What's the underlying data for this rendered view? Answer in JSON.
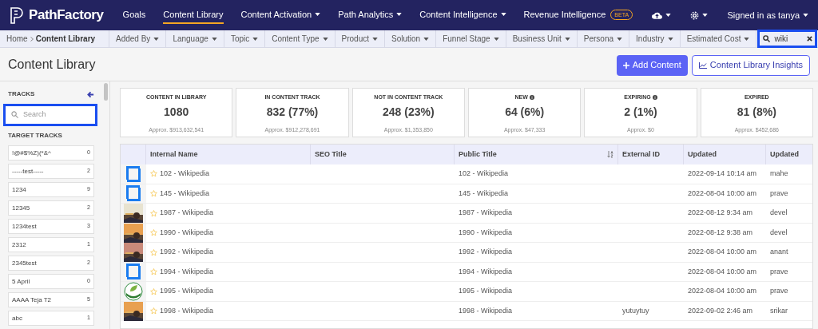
{
  "brand": {
    "name": "PathFactory"
  },
  "nav": [
    {
      "label": "Goals",
      "selected": false,
      "caret": false
    },
    {
      "label": "Content Library",
      "selected": true,
      "caret": false
    },
    {
      "label": "Content Activation",
      "selected": false,
      "caret": true
    },
    {
      "label": "Path Analytics",
      "selected": false,
      "caret": true
    },
    {
      "label": "Content Intelligence",
      "selected": false,
      "caret": true
    },
    {
      "label": "Revenue Intelligence",
      "selected": false,
      "caret": false,
      "badge": "BETA"
    }
  ],
  "user": {
    "label": "Signed in as tanya"
  },
  "breadcrumb": [
    "Home",
    "Content Library"
  ],
  "filters": [
    "Added By",
    "Language",
    "Topic",
    "Content Type",
    "Product",
    "Solution",
    "Funnel Stage",
    "Business Unit",
    "Persona",
    "Industry",
    "Estimated Cost"
  ],
  "search": {
    "value": "wiki"
  },
  "page": {
    "title": "Content Library",
    "buttons": [
      {
        "kind": "primary",
        "label": "Add Content"
      },
      {
        "kind": "outline",
        "label": "Content Library Insights"
      }
    ]
  },
  "sidebar": {
    "title": "TRACKS",
    "search": {
      "placeholder": "Search"
    },
    "section": "TARGET TRACKS",
    "tracks": [
      {
        "name": "!@#$%Z)(*&^",
        "count": "0"
      },
      {
        "name": "-----test-----",
        "count": "2"
      },
      {
        "name": "1234",
        "count": "9"
      },
      {
        "name": "12345",
        "count": "2"
      },
      {
        "name": "1234test",
        "count": "3"
      },
      {
        "name": "2312",
        "count": "1"
      },
      {
        "name": "2345test",
        "count": "2"
      },
      {
        "name": "5 April",
        "count": "0"
      },
      {
        "name": "AAAA Teja T2",
        "count": "5"
      },
      {
        "name": "abc",
        "count": "1"
      }
    ]
  },
  "stats": [
    {
      "title": "CONTENT IN LIBRARY",
      "info": false,
      "value": "1080",
      "approx": "Approx. $913,632,541"
    },
    {
      "title": "IN CONTENT TRACK",
      "info": false,
      "value": "832 (77%)",
      "approx": "Approx. $912,278,691"
    },
    {
      "title": "NOT IN CONTENT TRACK",
      "info": false,
      "value": "248 (23%)",
      "approx": "Approx. $1,353,850"
    },
    {
      "title": "NEW",
      "info": true,
      "value": "64 (6%)",
      "approx": "Approx. $47,333"
    },
    {
      "title": "EXPIRING",
      "info": true,
      "value": "2 (1%)",
      "approx": "Approx. $0"
    },
    {
      "title": "EXPIRED",
      "info": false,
      "value": "81 (8%)",
      "approx": "Approx. $452,686"
    }
  ],
  "table": {
    "columns": [
      {
        "label": "Internal Name",
        "sort": false
      },
      {
        "label": "SEO Title",
        "sort": false
      },
      {
        "label": "Public Title",
        "sort": true
      },
      {
        "label": "External ID",
        "sort": false
      },
      {
        "label": "Updated",
        "sort": false
      },
      {
        "label": "Updated",
        "sort": false
      }
    ],
    "rows": [
      {
        "kind": "square",
        "starred": false,
        "internal_name": "102 - Wikipedia",
        "public_title": "102 - Wikipedia",
        "external_id": "",
        "updated": "2022-09-14 10:14 am",
        "updated_by": "mahe"
      },
      {
        "kind": "square",
        "starred": false,
        "internal_name": "145 - Wikipedia",
        "public_title": "145 - Wikipedia",
        "external_id": "",
        "updated": "2022-08-04 10:00 am",
        "updated_by": "prave"
      },
      {
        "kind": "picture",
        "starred": false,
        "internal_name": "1987 - Wikipedia",
        "public_title": "1987 - Wikipedia",
        "external_id": "",
        "updated": "2022-08-12 9:34 am",
        "updated_by": "devel"
      },
      {
        "kind": "picture",
        "starred": false,
        "internal_name": "1990 - Wikipedia",
        "public_title": "1990 - Wikipedia",
        "external_id": "",
        "updated": "2022-08-12 9:38 am",
        "updated_by": "devel"
      },
      {
        "kind": "picture",
        "starred": false,
        "internal_name": "1992 - Wikipedia",
        "public_title": "1992 - Wikipedia",
        "external_id": "",
        "updated": "2022-08-04 10:00 am",
        "updated_by": "anant"
      },
      {
        "kind": "square",
        "starred": false,
        "internal_name": "1994 - Wikipedia",
        "public_title": "1994 - Wikipedia",
        "external_id": "",
        "updated": "2022-08-04 10:00 am",
        "updated_by": "prave"
      },
      {
        "kind": "leaf",
        "starred": false,
        "internal_name": "1995 - Wikipedia",
        "public_title": "1995 - Wikipedia",
        "external_id": "",
        "updated": "2022-08-04 10:00 am",
        "updated_by": "prave"
      },
      {
        "kind": "picture",
        "starred": false,
        "internal_name": "1998 - Wikipedia",
        "public_title": "1998 - Wikipedia",
        "external_id": "yutuytuy",
        "updated": "2022-09-02 2:46 am",
        "updated_by": "srikar"
      }
    ]
  }
}
